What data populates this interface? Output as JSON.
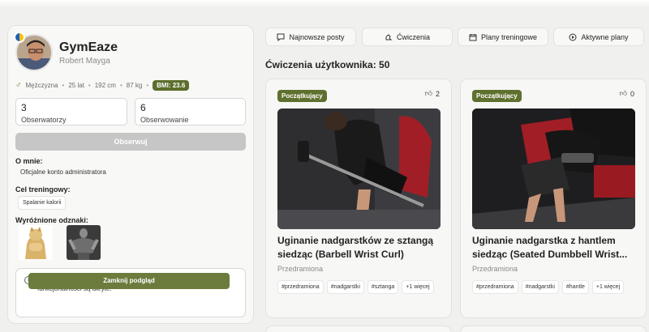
{
  "profile": {
    "app_name": "GymEaze",
    "user_name": "Robert Mayga",
    "gender": "Mężczyzna",
    "age": "25 lat",
    "height": "192 cm",
    "weight": "87 kg",
    "bmi": "BMI: 23.6",
    "followers_count": "3",
    "followers_label": "Obserwatorzy",
    "following_count": "6",
    "following_label": "Obserwowanie",
    "follow_button": "Obserwuj",
    "about_label": "O mnie:",
    "about_text": "Oficjalne konto administratora",
    "goal_label": "Cel treningowy:",
    "goal_value": "Spalanie kalorii",
    "badges_label": "Wyróżnione odznaki:",
    "notice_text": "Przeglądasz swój profil jako gość. Niektóre informacje i funkcjonalności są ukryte.",
    "close_preview_button": "Zamknij podgląd"
  },
  "tabs": [
    {
      "label": "Najnowsze posty",
      "icon": "chat-icon"
    },
    {
      "label": "Ćwiczenia",
      "icon": "dumbbell-icon"
    },
    {
      "label": "Plany treningowe",
      "icon": "calendar-icon"
    },
    {
      "label": "Aktywne plany",
      "icon": "play-circle-icon"
    }
  ],
  "exercises_title": "Ćwiczenia użytkownika: 50",
  "cards": [
    {
      "level": "Początkujący",
      "likes": "2",
      "title_line1": "Uginanie nadgarstków ze sztangą",
      "title_line2": "siedząc (Barbell Wrist Curl)",
      "subtitle": "Przedramiona",
      "tags": [
        "#przedramiona",
        "#nadgarstki",
        "#sztanga",
        "+1 więcej"
      ]
    },
    {
      "level": "Początkujący",
      "likes": "0",
      "title_line1": "Uginanie nadgarstka z hantlem",
      "title_line2": "siedząc (Seated Dumbbell Wrist...",
      "subtitle": "Przedramiona",
      "tags": [
        "#przedramiona",
        "#nadgarstki",
        "#hantle",
        "+1 więcej"
      ]
    }
  ],
  "colors": {
    "accent": "#5e702e",
    "button_disabled": "#c6c6c6",
    "background": "#f0f0ee"
  }
}
